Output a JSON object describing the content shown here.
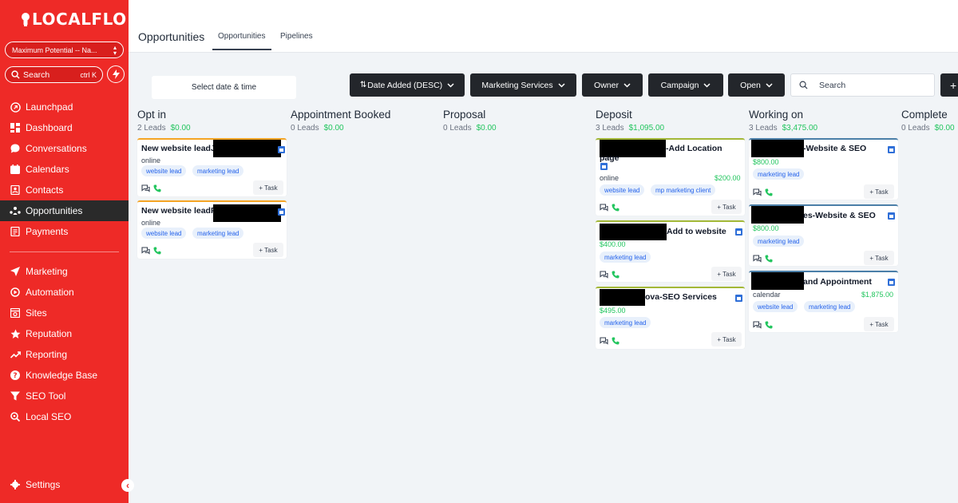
{
  "sidebar": {
    "logo_text": "LOCALFLO",
    "account_name": "Maximum Potential -- Na...",
    "search_label": "Search",
    "search_shortcut": "ctrl K",
    "nav": [
      {
        "label": "Launchpad",
        "icon": "launchpad-icon"
      },
      {
        "label": "Dashboard",
        "icon": "dashboard-icon"
      },
      {
        "label": "Conversations",
        "icon": "chat-icon"
      },
      {
        "label": "Calendars",
        "icon": "calendar-icon"
      },
      {
        "label": "Contacts",
        "icon": "contacts-icon"
      },
      {
        "label": "Opportunities",
        "icon": "opportunities-icon",
        "active": true
      },
      {
        "label": "Payments",
        "icon": "payments-icon"
      },
      {
        "label": "Marketing",
        "icon": "send-icon"
      },
      {
        "label": "Automation",
        "icon": "automation-icon"
      },
      {
        "label": "Sites",
        "icon": "sites-icon"
      },
      {
        "label": "Reputation",
        "icon": "star-icon"
      },
      {
        "label": "Reporting",
        "icon": "trend-icon"
      },
      {
        "label": "Knowledge Base",
        "icon": "question-icon"
      },
      {
        "label": "SEO Tool",
        "icon": "filter-icon"
      },
      {
        "label": "Local SEO",
        "icon": "search-location-icon"
      }
    ],
    "settings_label": "Settings",
    "colors": {
      "brand": "#ee2a27",
      "active_bg": "#2a2a2a"
    }
  },
  "header": {
    "title": "Opportunities",
    "tabs": [
      {
        "label": "Opportunities",
        "active": true
      },
      {
        "label": "Pipelines"
      }
    ]
  },
  "filters": {
    "date_placeholder": "Select date & time",
    "sort": "Date Added (DESC)",
    "pipeline": "Marketing Services",
    "owner": "Owner",
    "campaign": "Campaign",
    "status": "Open",
    "search_placeholder": "Search"
  },
  "task_label": "+ Task",
  "columns": [
    {
      "name": "Opt in",
      "leads": "2 Leads",
      "amount": "$0.00"
    },
    {
      "name": "Appointment Booked",
      "leads": "0 Leads",
      "amount": "$0.00"
    },
    {
      "name": "Proposal",
      "leads": "0 Leads",
      "amount": "$0.00"
    },
    {
      "name": "Deposit",
      "leads": "3 Leads",
      "amount": "$1,095.00"
    },
    {
      "name": "Working on",
      "leads": "3 Leads",
      "amount": "$3,475.00"
    },
    {
      "name": "Complete",
      "leads": "0 Leads",
      "amount": "$0.00"
    }
  ],
  "cards": {
    "optin_1": {
      "title": "New website leadJ",
      "source": "online",
      "tags": [
        "website lead",
        "marketing lead"
      ]
    },
    "optin_2": {
      "title": "New website leadF",
      "source": "online",
      "tags": [
        "website lead",
        "marketing lead"
      ]
    },
    "deposit_1": {
      "title": "-Add Location",
      "title_line2": "page",
      "source": "online",
      "value": "$200.00",
      "tags": [
        "website lead",
        "mp marketing client"
      ]
    },
    "deposit_2": {
      "title": "Add to website",
      "value": "$400.00",
      "tags": [
        "marketing lead"
      ]
    },
    "deposit_3": {
      "title": "ova-SEO Services",
      "value": "$495.00",
      "tags": [
        "marketing lead"
      ]
    },
    "working_1": {
      "title": "-Website & SEO",
      "value": "$800.00",
      "tags": [
        "marketing lead"
      ]
    },
    "working_2": {
      "title": "es-Website & SEO",
      "value": "$800.00",
      "tags": [
        "marketing lead"
      ]
    },
    "working_3": {
      "title": "and Appointment",
      "source": "calendar",
      "value": "$1,875.00",
      "tags": [
        "website lead",
        "marketing lead"
      ]
    }
  }
}
